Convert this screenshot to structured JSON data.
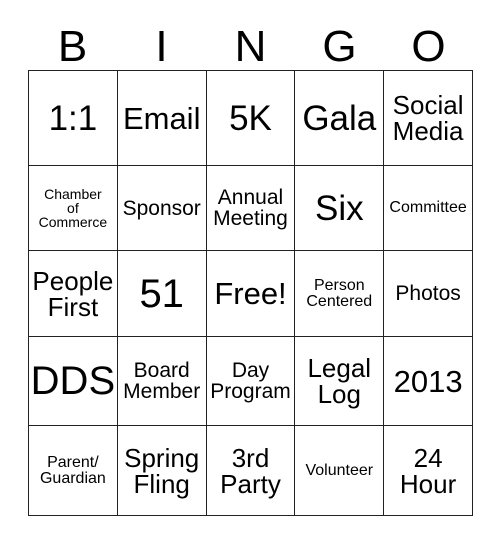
{
  "card": {
    "title_letters": [
      "B",
      "I",
      "N",
      "G",
      "O"
    ],
    "columns": 5,
    "rows": 5,
    "border_color": "#222222",
    "text_color": "#000000",
    "background_color": "#ffffff",
    "cells": [
      [
        {
          "text": "1:1",
          "size": "xl"
        },
        {
          "text": "Email",
          "size": "lg"
        },
        {
          "text": "5K",
          "size": "xl"
        },
        {
          "text": "Gala",
          "size": "xl"
        },
        {
          "text": "Social\nMedia",
          "size": "md"
        }
      ],
      [
        {
          "text": "Chamber\nof\nCommerce",
          "size": "xxs"
        },
        {
          "text": "Sponsor",
          "size": "sm"
        },
        {
          "text": "Annual\nMeeting",
          "size": "sm"
        },
        {
          "text": "Six",
          "size": "xl"
        },
        {
          "text": "Committee",
          "size": "xs"
        }
      ],
      [
        {
          "text": "People\nFirst",
          "size": "md"
        },
        {
          "text": "51",
          "size": "xxl"
        },
        {
          "text": "Free!",
          "size": "lg"
        },
        {
          "text": "Person\nCentered",
          "size": "xs"
        },
        {
          "text": "Photos",
          "size": "sm"
        }
      ],
      [
        {
          "text": "DDS",
          "size": "xxl"
        },
        {
          "text": "Board\nMember",
          "size": "sm"
        },
        {
          "text": "Day\nProgram",
          "size": "sm"
        },
        {
          "text": "Legal\nLog",
          "size": "md"
        },
        {
          "text": "2013",
          "size": "lg"
        }
      ],
      [
        {
          "text": "Parent/\nGuardian",
          "size": "xs"
        },
        {
          "text": "Spring\nFling",
          "size": "md"
        },
        {
          "text": "3rd\nParty",
          "size": "md"
        },
        {
          "text": "Volunteer",
          "size": "xs"
        },
        {
          "text": "24\nHour",
          "size": "md"
        }
      ]
    ]
  }
}
